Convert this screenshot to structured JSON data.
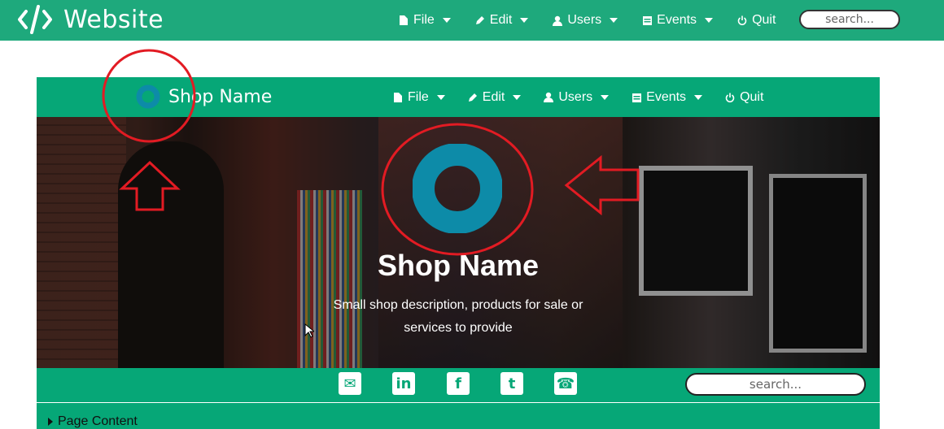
{
  "topbar": {
    "title": "Website",
    "menu": [
      {
        "label": "File",
        "icon": "file-icon"
      },
      {
        "label": "Edit",
        "icon": "pencil-icon"
      },
      {
        "label": "Users",
        "icon": "user-icon"
      },
      {
        "label": "Events",
        "icon": "calendar-icon"
      },
      {
        "label": "Quit",
        "icon": "power-icon"
      }
    ],
    "search_placeholder": "search..."
  },
  "preview": {
    "brand": "Shop Name",
    "menu": [
      {
        "label": "File",
        "icon": "file-icon"
      },
      {
        "label": "Edit",
        "icon": "pencil-icon"
      },
      {
        "label": "Users",
        "icon": "user-icon"
      },
      {
        "label": "Events",
        "icon": "calendar-icon"
      },
      {
        "label": "Quit",
        "icon": "power-icon"
      }
    ],
    "hero": {
      "title": "Shop Name",
      "description": "Small shop description, products for sale or services to provide"
    },
    "social": [
      {
        "icon": "email-icon",
        "glyph": "✉"
      },
      {
        "icon": "linkedin-icon",
        "glyph": "in"
      },
      {
        "icon": "facebook-icon",
        "glyph": "f"
      },
      {
        "icon": "twitter-icon",
        "glyph": "t"
      },
      {
        "icon": "phone-icon",
        "glyph": "☎"
      }
    ],
    "search_placeholder": "search...",
    "content_toggle": "Page Content"
  },
  "colors": {
    "topbar": "#1ea97c",
    "preview_green": "#06a777",
    "logo_teal": "#0d8ba8",
    "annotation_red": "#e21b23"
  }
}
